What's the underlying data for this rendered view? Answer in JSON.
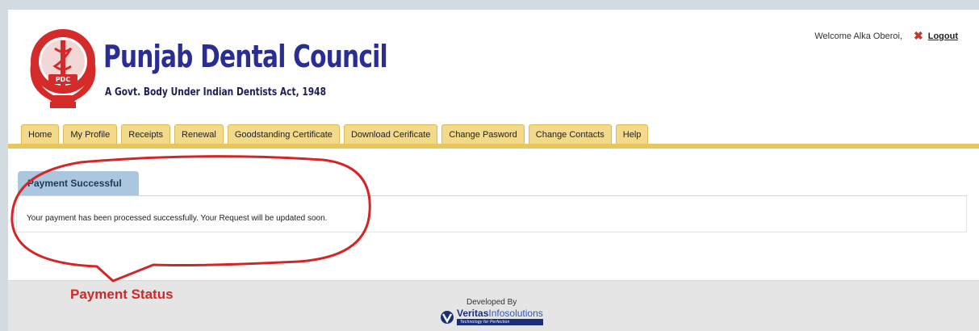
{
  "header": {
    "title": "Punjab Dental Council",
    "subtitle": "A Govt. Body Under Indian Dentists Act, 1948",
    "seal_top_text": "Punjab Dental Council",
    "seal_center_text": "PDC"
  },
  "user": {
    "welcome": "Welcome Alka Oberoi,",
    "logout_label": "Logout"
  },
  "nav": {
    "tabs": [
      {
        "label": "Home"
      },
      {
        "label": "My Profile"
      },
      {
        "label": "Receipts"
      },
      {
        "label": "Renewal"
      },
      {
        "label": "Goodstanding Certificate"
      },
      {
        "label": "Download Cerificate"
      },
      {
        "label": "Change Pasword"
      },
      {
        "label": "Change Contacts"
      },
      {
        "label": "Help"
      }
    ]
  },
  "panel": {
    "title": "Payment Successful",
    "message": "Your payment has been processed successfully. Your Request will be updated soon."
  },
  "annotation": {
    "label": "Payment Status",
    "color": "#d42626"
  },
  "footer": {
    "developed_by": "Developed By",
    "developer_name_bold": "Veritas",
    "developer_name_light": "Infosolutions",
    "developer_tagline": "Technology for Perfection"
  },
  "colors": {
    "nav_tab": "#f3d98a",
    "nav_bar": "#e8c65a",
    "brand": "#2a2d93",
    "panel_tab": "#aac7df",
    "seal": "#d52a2a"
  }
}
